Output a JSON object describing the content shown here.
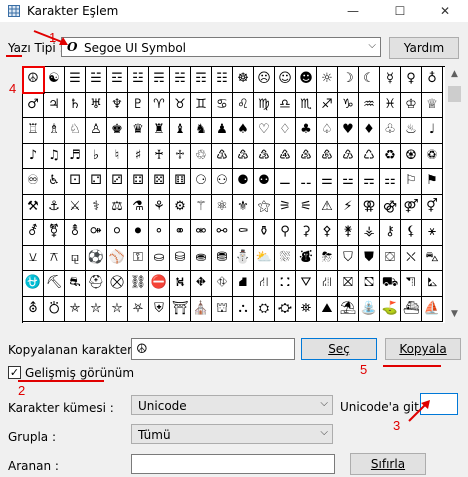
{
  "window": {
    "title": "Karakter Eşlem",
    "minimize": "—",
    "maximize": "☐",
    "close": "✕"
  },
  "font_row": {
    "label": "Yazı Tipi :",
    "font_icon": "O",
    "font_name": "Segoe UI Symbol",
    "help_button": "Yardım"
  },
  "grid": {
    "rows": [
      [
        "☮",
        "☯",
        "☰",
        "☱",
        "☲",
        "☳",
        "☴",
        "☵",
        "☶",
        "☷",
        "☸",
        "☹",
        "☺",
        "☻",
        "☼",
        "☽",
        "☾",
        "☿",
        "♀",
        "♁"
      ],
      [
        "♂",
        "♃",
        "♄",
        "♅",
        "♆",
        "♇",
        "♈",
        "♉",
        "♊",
        "♋",
        "♌",
        "♍",
        "♎",
        "♏",
        "♐",
        "♑",
        "♒",
        "♓",
        "♔",
        "♕"
      ],
      [
        "♖",
        "♗",
        "♘",
        "♙",
        "♚",
        "♛",
        "♜",
        "♝",
        "♞",
        "♟",
        "♠",
        "♡",
        "♢",
        "♣",
        "♤",
        "♥",
        "♦",
        "♧",
        "♨",
        "♩"
      ],
      [
        "♪",
        "♫",
        "♬",
        "♭",
        "♮",
        "♯",
        "♰",
        "♱",
        "♲",
        "♳",
        "♴",
        "♵",
        "♶",
        "♷",
        "♸",
        "♹",
        "♺",
        "♻",
        "♼",
        "♽"
      ],
      [
        "♾",
        "♿",
        "⚀",
        "⚁",
        "⚂",
        "⚃",
        "⚄",
        "⚅",
        "⚆",
        "⚇",
        "⚈",
        "⚉",
        "⚊",
        "⚋",
        "⚌",
        "⚍",
        "⚎",
        "⚏",
        "⚐",
        "⚑"
      ],
      [
        "⚒",
        "⚓",
        "⚔",
        "⚕",
        "⚖",
        "⚗",
        "⚘",
        "⚙",
        "⚚",
        "⚛",
        "⚜",
        "⚝",
        "⚞",
        "⚟",
        "⚠",
        "⚡",
        "⚢",
        "⚣",
        "⚤",
        "⚥"
      ],
      [
        "⚦",
        "⚧",
        "⚨",
        "⚩",
        "⚪",
        "⚫",
        "⚬",
        "⚭",
        "⚮",
        "⚯",
        "⚰",
        "⚱",
        "⚲",
        "⚳",
        "⚴",
        "⚵",
        "⚶",
        "⚷",
        "⚸",
        "⚹"
      ],
      [
        "⚺",
        "⚻",
        "⚼",
        "⚽",
        "⚾",
        "⚿",
        "⛀",
        "⛁",
        "⛂",
        "⛃",
        "⛄",
        "⛅",
        "⛆",
        "⛇",
        "⛈",
        "⛉",
        "⛊",
        "⛋",
        "⛌",
        "⛍"
      ],
      [
        "⛎",
        "⛏",
        "⛐",
        "⛑",
        "⛒",
        "⛓",
        "⛔",
        "⛕",
        "⛖",
        "⛗",
        "⛘",
        "⛙",
        "⛚",
        "⛛",
        "⛜",
        "⛝",
        "⛞",
        "⛟",
        "⛠",
        "⛡"
      ],
      [
        "⛢",
        "⛣",
        "⛤",
        "⛥",
        "⛦",
        "⛧",
        "⛨",
        "⛩",
        "⛪",
        "⛫",
        "⛬",
        "⛭",
        "⛮",
        "⛯",
        "⛰",
        "⛱",
        "⛲",
        "⛳",
        "⛴",
        "⛵"
      ]
    ]
  },
  "copy_row": {
    "label": "Kopyalanan karakterler :",
    "value": "☮",
    "select_button": "Seç",
    "copy_button": "Kopyala"
  },
  "advanced": {
    "checkbox_label": "Gelişmiş görünüm",
    "checked": true
  },
  "charset": {
    "label": "Karakter kümesi :",
    "value": "Unicode",
    "goto_label": "Unicode'a git :",
    "goto_value": ""
  },
  "group": {
    "label": "Grupla :",
    "value": "Tümü"
  },
  "search": {
    "label": "Aranan :",
    "value": "",
    "reset_button": "Sıfırla"
  },
  "annotations": {
    "a1": "1",
    "a2": "2",
    "a3": "3",
    "a4": "4",
    "a5": "5"
  },
  "colors": {
    "annotation": "#e00000",
    "focus": "#0078d7"
  }
}
